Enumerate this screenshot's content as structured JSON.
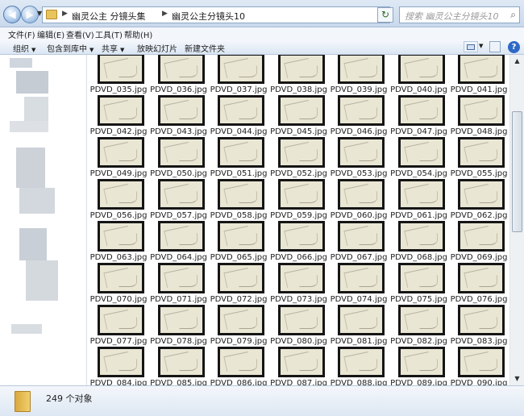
{
  "address": {
    "crumbs": [
      "幽灵公主 分镜头集",
      "幽灵公主分镜头10"
    ],
    "search_placeholder": "搜索 幽灵公主分镜头10"
  },
  "menu": [
    "文件(F)",
    "编辑(E)",
    "查看(V)",
    "工具(T)",
    "帮助(H)"
  ],
  "toolbar": {
    "organize": "组织",
    "include": "包含到库中",
    "share": "共享",
    "slideshow": "放映幻灯片",
    "new_folder": "新建文件夹"
  },
  "files": [
    "PDVD_035.jpg",
    "PDVD_036.jpg",
    "PDVD_037.jpg",
    "PDVD_038.jpg",
    "PDVD_039.jpg",
    "PDVD_040.jpg",
    "PDVD_041.jpg",
    "PDVD_042.jpg",
    "PDVD_043.jpg",
    "PDVD_044.jpg",
    "PDVD_045.jpg",
    "PDVD_046.jpg",
    "PDVD_047.jpg",
    "PDVD_048.jpg",
    "PDVD_049.jpg",
    "PDVD_050.jpg",
    "PDVD_051.jpg",
    "PDVD_052.jpg",
    "PDVD_053.jpg",
    "PDVD_054.jpg",
    "PDVD_055.jpg",
    "PDVD_056.jpg",
    "PDVD_057.jpg",
    "PDVD_058.jpg",
    "PDVD_059.jpg",
    "PDVD_060.jpg",
    "PDVD_061.jpg",
    "PDVD_062.jpg",
    "PDVD_063.jpg",
    "PDVD_064.jpg",
    "PDVD_065.jpg",
    "PDVD_066.jpg",
    "PDVD_067.jpg",
    "PDVD_068.jpg",
    "PDVD_069.jpg",
    "PDVD_070.jpg",
    "PDVD_071.jpg",
    "PDVD_072.jpg",
    "PDVD_073.jpg",
    "PDVD_074.jpg",
    "PDVD_075.jpg",
    "PDVD_076.jpg",
    "PDVD_077.jpg",
    "PDVD_078.jpg",
    "PDVD_079.jpg",
    "PDVD_080.jpg",
    "PDVD_081.jpg",
    "PDVD_082.jpg",
    "PDVD_083.jpg",
    "PDVD_084.jpg",
    "PDVD_085.jpg",
    "PDVD_086.jpg",
    "PDVD_087.jpg",
    "PDVD_088.jpg",
    "PDVD_089.jpg",
    "PDVD_090.jpg"
  ],
  "details": {
    "count": "249 个对象"
  },
  "colors": {
    "toolbar_bg": "#dbe6f3",
    "thumb_border": "#151515",
    "sketch_paper": "#e9e6d4"
  }
}
